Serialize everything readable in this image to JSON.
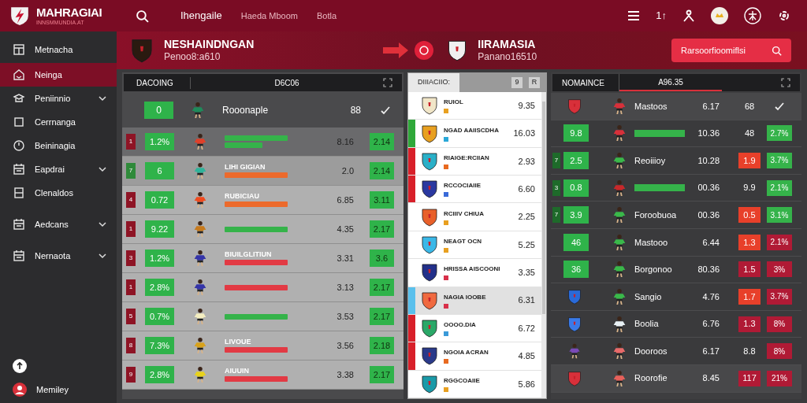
{
  "topbar": {
    "brand": "MAHRAGIAI",
    "brand_sub": "INNSMMUNDIA.AT",
    "nav": [
      {
        "label": "Ihengaile",
        "selected": true
      },
      {
        "label": "Haeda Mboom",
        "selected": false
      },
      {
        "label": "Botla",
        "selected": false
      }
    ],
    "short_label": "1↑"
  },
  "sidebar": {
    "items": [
      {
        "label": "Metnacha",
        "selected": false,
        "expandable": false
      },
      {
        "label": "Neinga",
        "selected": true,
        "expandable": false
      },
      {
        "label": "Peniinnio",
        "selected": false,
        "expandable": true
      },
      {
        "label": "Cerrnanga",
        "selected": false,
        "expandable": false
      },
      {
        "label": "Beininagia",
        "selected": false,
        "expandable": false
      },
      {
        "label": "Eapdrai",
        "selected": false,
        "expandable": true
      },
      {
        "label": "Clenaldos",
        "selected": false,
        "expandable": false
      },
      {
        "label": "Aedcans",
        "selected": false,
        "expandable": true
      },
      {
        "label": "Nernaota",
        "selected": false,
        "expandable": true
      }
    ],
    "footer_user": "Memiley"
  },
  "banner": {
    "home": {
      "name": "NESHAINDNGAN",
      "sub": "Penoo8:a610"
    },
    "away": {
      "name": "IIRAMASIA",
      "sub": "Panano16510"
    },
    "search_button": "Rarsoorfioomiflsi"
  },
  "left_table": {
    "columns": [
      "DACOING",
      "D6C06"
    ],
    "top_row": {
      "value": "0",
      "name": "Rooonaple",
      "score": "88",
      "player": {
        "color": "#1f8a5a"
      }
    },
    "rows": [
      {
        "rank": {
          "text": "1",
          "color": "#8e1425"
        },
        "value": "1.2%",
        "tags": [
          {
            "color": "#35b34a"
          },
          {
            "color": "#35b34a"
          }
        ],
        "player": {
          "color": "#e0402a"
        },
        "score": "8.16",
        "odds": "2.14",
        "selected": false
      },
      {
        "rank": {
          "text": "7",
          "color": "#2f8a3a"
        },
        "value": "6",
        "name": "LIHI GIGIAN",
        "tags": [
          {
            "color": "#ec6a2c"
          }
        ],
        "player": {
          "color": "#2fb39a"
        },
        "score": "2.0",
        "odds": "2.14",
        "selected": true
      },
      {
        "rank": {
          "text": "4",
          "color": "#8e1425"
        },
        "value": "0.72",
        "name": "RUBICIAU",
        "tags": [
          {
            "color": "#ec6a2c"
          }
        ],
        "player": {
          "color": "#f04a1e"
        },
        "score": "6.85",
        "odds": "3.11",
        "selected": false
      },
      {
        "rank": {
          "text": "1",
          "color": "#8e1425"
        },
        "value": "9.22",
        "tags": [
          {
            "color": "#35b34a"
          }
        ],
        "player": {
          "color": "#c77a1c"
        },
        "score": "4.35",
        "odds": "2.17",
        "selected": false
      },
      {
        "rank": {
          "text": "3",
          "color": "#8e1425"
        },
        "value": "1.2%",
        "name": "BIUILGLITIUN",
        "tags": [
          {
            "color": "#e23a44"
          }
        ],
        "player": {
          "color": "#3434a8"
        },
        "score": "3.31",
        "odds": "3.6",
        "selected": false
      },
      {
        "rank": {
          "text": "1",
          "color": "#8e1425"
        },
        "value": "2.8%",
        "tags": [
          {
            "color": "#e23a44"
          }
        ],
        "player": {
          "color": "#3434a8"
        },
        "score": "3.13",
        "odds": "2.17",
        "selected": false
      },
      {
        "rank": {
          "text": "5",
          "color": "#8e1425"
        },
        "value": "0.7%",
        "tags": [
          {
            "color": "#35b34a"
          }
        ],
        "player": {
          "color": "#f4eec0"
        },
        "score": "3.53",
        "odds": "2.17",
        "selected": false
      },
      {
        "rank": {
          "text": "8",
          "color": "#8e1425"
        },
        "value": "7.3%",
        "name": "LIVOUE",
        "tags": [
          {
            "color": "#e23a44"
          }
        ],
        "player": {
          "color": "#d8a21c"
        },
        "score": "3.56",
        "odds": "2.18",
        "selected": false
      },
      {
        "rank": {
          "text": "9",
          "color": "#8e1425"
        },
        "value": "2.8%",
        "name": "AIUUIN",
        "tags": [
          {
            "color": "#e23a44"
          }
        ],
        "player": {
          "color": "#e8d21c"
        },
        "score": "3.38",
        "odds": "2.17",
        "selected": false
      }
    ]
  },
  "middle_list": {
    "tab": "DIIIACIIO:",
    "buttons": [
      "9",
      "R"
    ],
    "items": [
      {
        "name": "RUIOL",
        "value": "9.35",
        "crest": {
          "color": "#f1e6c8"
        },
        "color": "#e8a020",
        "selected": false
      },
      {
        "name": "NGAD AAIISCDHA",
        "value": "16.03",
        "stripe": {
          "color": "#2fa83a"
        },
        "crest": {
          "color": "#e8a020"
        },
        "color": "#2aa8d8",
        "selected": false
      },
      {
        "name": "RIAIGE:RCIIAN",
        "value": "2.93",
        "stripe": {
          "color": "#d8202a"
        },
        "crest": {
          "color": "#2ab0c8"
        },
        "color": "#e86a20",
        "selected": false
      },
      {
        "name": "RCCOCIAIIE",
        "value": "6.60",
        "stripe": {
          "color": "#d8202a"
        },
        "crest": {
          "color": "#2a38a0"
        },
        "color": "#3a6ad8",
        "selected": false
      },
      {
        "name": "RCIIIV CHIUA",
        "value": "2.25",
        "crest": {
          "color": "#e8602a"
        },
        "color": "#e8a020",
        "selected": false
      },
      {
        "name": "NEAGT OCN",
        "value": "5.25",
        "crest": {
          "color": "#3ab8e8"
        },
        "color": "#e8a020",
        "selected": false
      },
      {
        "name": "HRISSA AISCOONI",
        "value": "3.35",
        "crest": {
          "color": "#22308a"
        },
        "color": "#d8304a",
        "selected": false
      },
      {
        "name": "NAGIA IOOBE",
        "value": "6.31",
        "stripe": {
          "color": "#5ac0ec"
        },
        "crest": {
          "color": "#f06a40"
        },
        "color": "#d8304a",
        "selected": true
      },
      {
        "name": "OOOO.DIA",
        "value": "6.72",
        "stripe": {
          "color": "#d8202a"
        },
        "crest": {
          "color": "#2aa868"
        },
        "color": "#3a9ad8",
        "selected": false
      },
      {
        "name": "NGOIA ACRAN",
        "value": "4.85",
        "stripe": {
          "color": "#d8202a"
        },
        "crest": {
          "color": "#2a3a8a"
        },
        "color": "#e86a20",
        "selected": false
      },
      {
        "name": "RGGCOAIIE",
        "value": "5.86",
        "crest": {
          "color": "#1a9aa8"
        },
        "color": "#e8a020",
        "selected": false
      }
    ]
  },
  "right_table": {
    "tabs": [
      {
        "label": "NOMAINCE",
        "selected": false
      },
      {
        "label": "A96.35",
        "selected": true
      }
    ],
    "rows": [
      {
        "lead": {
          "kind": "crest",
          "color": "#d8303a"
        },
        "player": {
          "color": "#d8303a"
        },
        "name": "Mastoos",
        "value": "6.17",
        "c1": {
          "text": "68"
        },
        "c2": {
          "kind": "check"
        }
      },
      {
        "lead": {
          "kind": "box",
          "text": "9.8"
        },
        "player": {
          "color": "#d8303a"
        },
        "tag": {
          "color": "#35b34a"
        },
        "value": "10.36",
        "c1": {
          "text": "48"
        },
        "c2": {
          "kind": "pill",
          "text": "2.7%",
          "color": "#35b34a"
        }
      },
      {
        "lead": {
          "kind": "box",
          "text": "2.5",
          "rank": "7"
        },
        "player": {
          "color": "#3ab84a"
        },
        "name": "Reoiiioy",
        "value": "10.28",
        "c1": {
          "text": "1.9",
          "color": "#e8402a"
        },
        "c2": {
          "kind": "pill",
          "text": "3.7%",
          "color": "#35b34a"
        }
      },
      {
        "lead": {
          "kind": "box",
          "text": "0.8",
          "rank": "3"
        },
        "player": {
          "color": "#c8282a"
        },
        "tag": {
          "color": "#35b34a"
        },
        "value": "00.36",
        "c1": {
          "text": "9.9"
        },
        "c2": {
          "kind": "pill",
          "text": "2.1%",
          "color": "#35b34a"
        }
      },
      {
        "lead": {
          "kind": "box",
          "text": "3.9",
          "rank": "7"
        },
        "player": {
          "color": "#3ab84a"
        },
        "name": "Foroobuoa",
        "value": "00.36",
        "c1": {
          "text": "0.5",
          "color": "#e8402a"
        },
        "c2": {
          "kind": "pill",
          "text": "3.1%",
          "color": "#35b34a"
        }
      },
      {
        "lead": {
          "kind": "box",
          "text": "46"
        },
        "player": {
          "color": "#3ab84a"
        },
        "name": "Mastooo",
        "value": "6.44",
        "c1": {
          "text": "1.3",
          "color": "#e8402a"
        },
        "c2": {
          "kind": "pill",
          "text": "2.1%",
          "color": "#b01a35"
        }
      },
      {
        "lead": {
          "kind": "box",
          "text": "36"
        },
        "player": {
          "color": "#3ab84a"
        },
        "name": "Borgonoo",
        "value": "80.36",
        "c1": {
          "text": "1.5",
          "color": "#b01a35"
        },
        "c2": {
          "kind": "pill",
          "text": "3%",
          "color": "#b01a35"
        }
      },
      {
        "lead": {
          "kind": "crest",
          "color": "#2a6ad8"
        },
        "player": {
          "color": "#3ab84a"
        },
        "name": "Sangio",
        "value": "4.76",
        "c1": {
          "text": "1.7",
          "color": "#e8402a"
        },
        "c2": {
          "kind": "pill",
          "text": "3.7%",
          "color": "#b01a35"
        }
      },
      {
        "lead": {
          "kind": "crest",
          "color": "#3a7ae8"
        },
        "player": {
          "color": "#e8f0f4"
        },
        "name": "Boolia",
        "value": "6.76",
        "c1": {
          "text": "1.3",
          "color": "#b01a35"
        },
        "c2": {
          "kind": "pill",
          "text": "8%",
          "color": "#b01a35"
        }
      },
      {
        "lead": {
          "kind": "player",
          "color": "#7a4ab8"
        },
        "player": {
          "color": "#e86a6a"
        },
        "name": "Dooroos",
        "value": "6.17",
        "c1": {
          "text": "8.8"
        },
        "c2": {
          "kind": "pill",
          "text": "8%",
          "color": "#b01a35"
        }
      },
      {
        "lead": {
          "kind": "crest",
          "color": "#d8303a"
        },
        "player": {
          "color": "#e8605a"
        },
        "name": "Roorofie",
        "value": "8.45",
        "c1": {
          "text": "117",
          "color": "#b01a35"
        },
        "c2": {
          "kind": "pill",
          "text": "21%",
          "color": "#b01a35"
        }
      }
    ]
  }
}
